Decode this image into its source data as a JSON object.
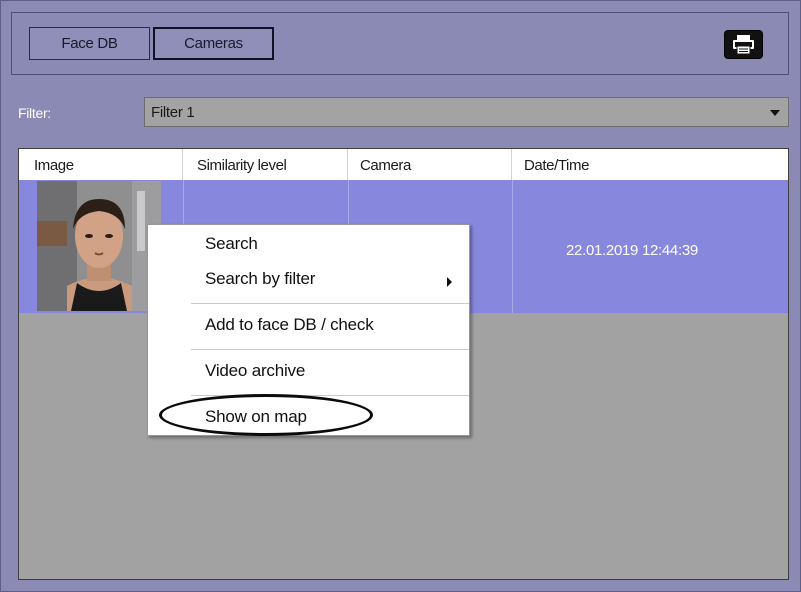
{
  "tabs": [
    {
      "label": "Face DB",
      "active": false
    },
    {
      "label": "Cameras",
      "active": true
    }
  ],
  "print_button": {
    "icon": "printer-icon"
  },
  "filter": {
    "label": "Filter:",
    "selected": "Filter 1"
  },
  "table": {
    "columns": [
      "Image",
      "Similarity level",
      "Camera",
      "Date/Time"
    ],
    "rows": [
      {
        "image": "face-thumbnail",
        "similarity": "",
        "camera": "",
        "datetime": "22.01.2019 12:44:39"
      }
    ]
  },
  "context_menu": {
    "items": [
      {
        "label": "Search"
      },
      {
        "label": "Search by filter",
        "has_submenu": true
      },
      {
        "label": "Add to face DB / check"
      },
      {
        "label": "Video archive"
      },
      {
        "label": "Show on map",
        "highlighted": true
      }
    ]
  },
  "colors": {
    "panel_bg": "#8a8ab5",
    "selected_row": "#8787dd",
    "grid_bg": "#a2a2a2"
  }
}
